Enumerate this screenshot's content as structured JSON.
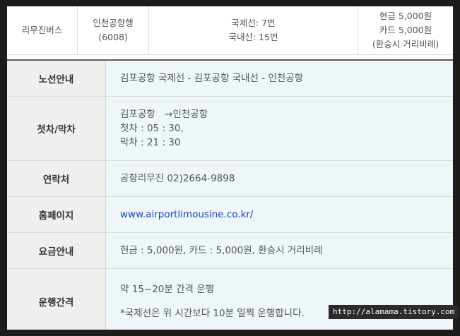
{
  "summary": {
    "type": "리무진버스",
    "destination": "인천공항행",
    "route_no": "(6008)",
    "stop_intl": "국제선: 7번",
    "stop_dom": "국내선: 15번",
    "fare_cash": "현금 5,000원",
    "fare_card": "카드 5,000원",
    "fare_note": "(환승시 거리비례)"
  },
  "rows": {
    "route": {
      "label": "노선안내",
      "value": "김포공항 국제선 - 김포공항 국내선 - 인천공항"
    },
    "schedule": {
      "label": "첫차/막차",
      "line1": "김포공항　→인천공항",
      "line2": "첫차 : 05 : 30,",
      "line3": "막차 : 21 : 30"
    },
    "contact": {
      "label": "연락처",
      "value": "공항리무진 02)2664-9898"
    },
    "homepage": {
      "label": "홈페이지",
      "value": "www.airportlimousine.co.kr/"
    },
    "fare": {
      "label": "요금안내",
      "value": "현금 : 5,000원, 카드 : 5,000원, 환승시 거리비례"
    },
    "interval": {
      "label": "운행간격",
      "line1": "약 15~20분 간격 운행",
      "line2": "*국제선은 위 시간보다 10분 일찍 운행합니다."
    }
  },
  "watermark": "http://alamama.tistory.com"
}
